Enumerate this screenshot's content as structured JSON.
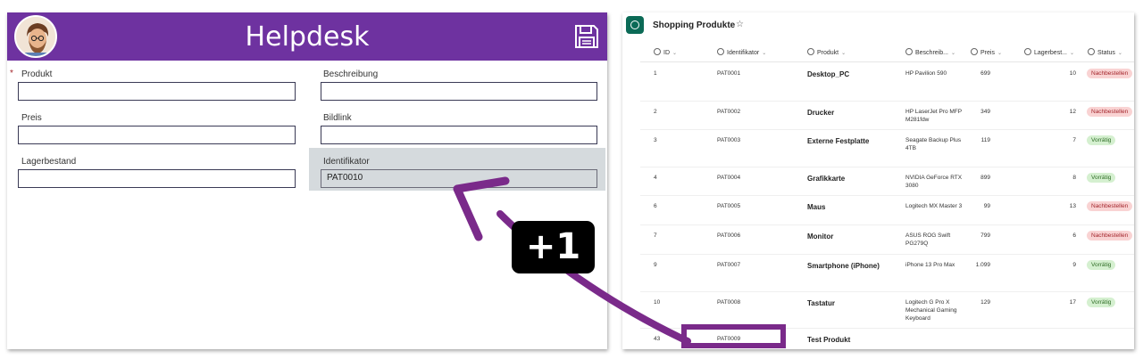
{
  "app": {
    "title": "Helpdesk",
    "required_marker": "*",
    "fields": {
      "produkt": {
        "label": "Produkt",
        "value": ""
      },
      "preis": {
        "label": "Preis",
        "value": ""
      },
      "lagerbestand": {
        "label": "Lagerbestand",
        "value": ""
      },
      "beschreibung": {
        "label": "Beschreibung",
        "value": ""
      },
      "bildlink": {
        "label": "Bildlink",
        "value": ""
      },
      "identifikator": {
        "label": "Identifikator",
        "value": "PAT0010"
      }
    },
    "icons": {
      "avatar": "avatar-illustration",
      "save": "save-floppy-icon"
    },
    "header_color": "#6e32a0"
  },
  "list": {
    "title": "Shopping Produkte",
    "star": "☆",
    "columns": {
      "id": "ID",
      "identifikator": "Identifikator",
      "produkt": "Produkt",
      "beschreibung": "Beschreib...",
      "preis": "Preis",
      "lagerbestand": "Lagerbest...",
      "status": "Status"
    },
    "rows": [
      {
        "id": "1",
        "ident": "PAT0001",
        "produkt": "Desktop_PC",
        "beschreibung": "HP Pavilion 590",
        "preis": "699",
        "lager": "10",
        "status": "Nachbestellen"
      },
      {
        "id": "2",
        "ident": "PAT0002",
        "produkt": "Drucker",
        "beschreibung": "HP LaserJet Pro MFP M281fdw",
        "preis": "349",
        "lager": "12",
        "status": "Nachbestellen"
      },
      {
        "id": "3",
        "ident": "PAT0003",
        "produkt": "Externe Festplatte",
        "beschreibung": "Seagate Backup Plus 4TB",
        "preis": "119",
        "lager": "7",
        "status": "Vorrätig"
      },
      {
        "id": "4",
        "ident": "PAT0004",
        "produkt": "Grafikkarte",
        "beschreibung": "NVIDIA GeForce RTX 3080",
        "preis": "899",
        "lager": "8",
        "status": "Vorrätig"
      },
      {
        "id": "6",
        "ident": "PAT0005",
        "produkt": "Maus",
        "beschreibung": "Logitech MX Master 3",
        "preis": "99",
        "lager": "13",
        "status": "Nachbestellen"
      },
      {
        "id": "7",
        "ident": "PAT0006",
        "produkt": "Monitor",
        "beschreibung": "ASUS ROG Swift PG279Q",
        "preis": "799",
        "lager": "6",
        "status": "Nachbestellen"
      },
      {
        "id": "9",
        "ident": "PAT0007",
        "produkt": "Smartphone (iPhone)",
        "beschreibung": "iPhone 13 Pro Max",
        "preis": "1.099",
        "lager": "9",
        "status": "Vorrätig"
      },
      {
        "id": "10",
        "ident": "PAT0008",
        "produkt": "Tastatur",
        "beschreibung": "Logitech G Pro X Mechanical Gaming Keyboard",
        "preis": "129",
        "lager": "17",
        "status": "Vorrätig"
      },
      {
        "id": "43",
        "ident": "PAT0009",
        "produkt": "Test Produkt",
        "beschreibung": "",
        "preis": "",
        "lager": "",
        "status": ""
      }
    ],
    "status_colors": {
      "Nachbestellen": "#f9d3d3",
      "Vorrätig": "#d5f0d0"
    }
  },
  "annotation": {
    "badge_text": "+1",
    "accent_color": "#7a2a8a"
  }
}
